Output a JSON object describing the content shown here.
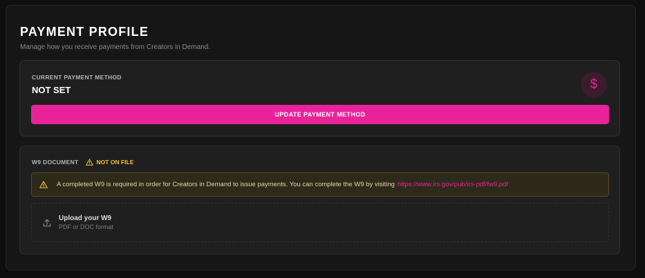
{
  "header": {
    "title": "PAYMENT PROFILE",
    "subtitle": "Manage how you receive payments from Creators in Demand."
  },
  "payment_method": {
    "label": "CURRENT PAYMENT METHOD",
    "value": "NOT SET",
    "icon_glyph": "$",
    "icon": "dollar-icon",
    "button_label": "UPDATE PAYMENT METHOD"
  },
  "w9": {
    "label": "W9 DOCUMENT",
    "status": "NOT ON FILE",
    "status_icon": "warning-icon",
    "alert_text": "A completed W9 is required in order for Creators in Demand to issue payments. You can complete the W9 by visiting",
    "alert_link": "https://www.irs.gov/pub/irs-pdf/fw9.pdf",
    "upload_title": "Upload your W9",
    "upload_subtitle": "PDF or DOC format",
    "upload_icon": "upload-icon"
  },
  "colors": {
    "accent": "#e8239a",
    "warning": "#f2c230",
    "background": "#161616",
    "card": "#1f1f1f"
  }
}
